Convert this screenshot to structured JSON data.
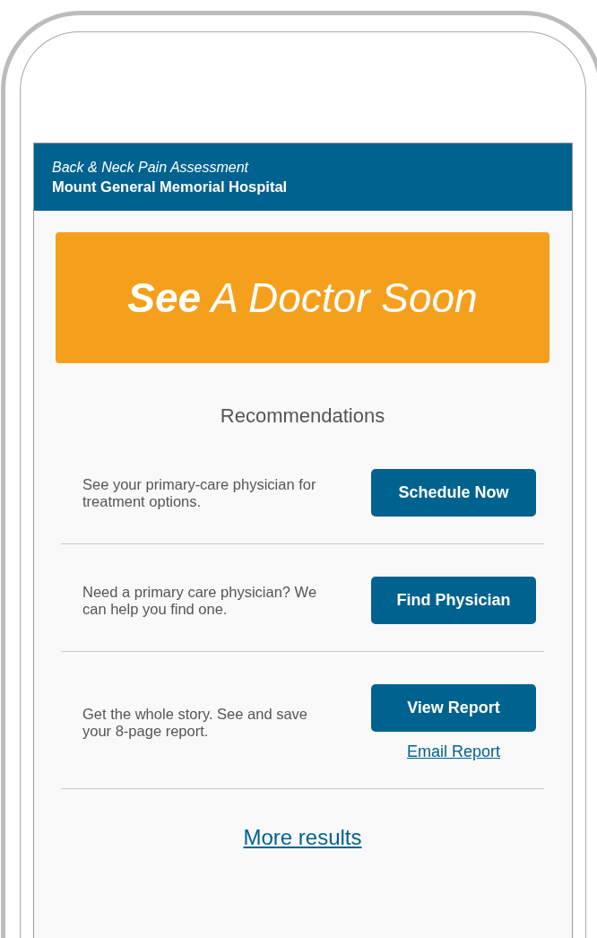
{
  "header": {
    "subtitle": "Back & Neck Pain Assessment",
    "title": "Mount General Memorial Hospital"
  },
  "banner": {
    "text": "**See** A Doctor Soon"
  },
  "recommendations": {
    "heading": "Recommendations",
    "items": [
      {
        "text": "See your primary-care physician for treatment options.",
        "button": "Schedule Now"
      },
      {
        "text": "Need a primary care physician? We can help you find one.",
        "button": "Find Physician"
      },
      {
        "text": "Get the whole story. See and save your 8-page report.",
        "button": "View Report",
        "link": "Email Report"
      }
    ]
  },
  "more_link": "More results"
}
